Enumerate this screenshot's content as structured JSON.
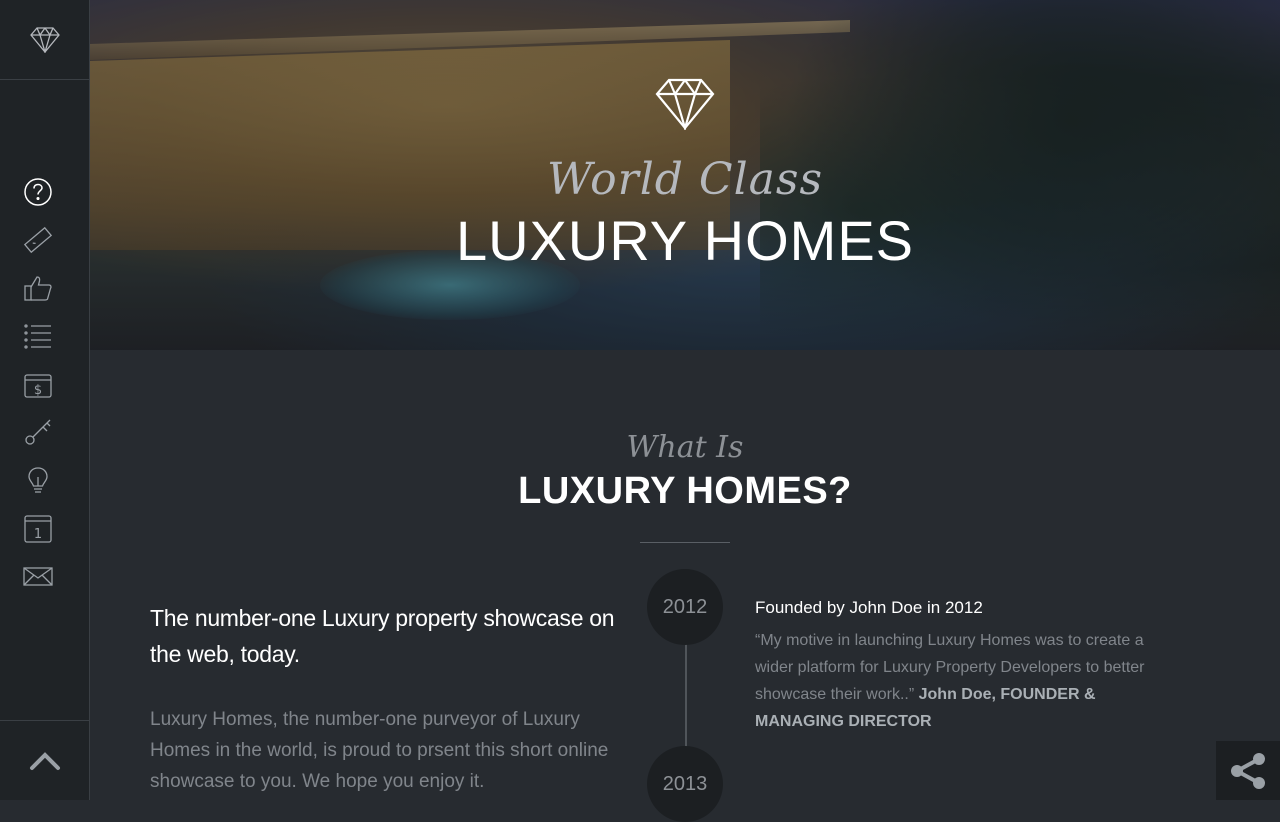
{
  "hero": {
    "script_text": "World Class",
    "title": "LUXURY HOMES"
  },
  "sidebar": {
    "logo_icon": "diamond-icon",
    "items": [
      {
        "icon": "question-icon"
      },
      {
        "icon": "ruler-icon"
      },
      {
        "icon": "thumbs-up-icon"
      },
      {
        "icon": "list-icon"
      },
      {
        "icon": "money-icon"
      },
      {
        "icon": "key-icon"
      },
      {
        "icon": "lightbulb-icon"
      },
      {
        "icon": "calendar-icon"
      },
      {
        "icon": "envelope-icon"
      }
    ],
    "bottom_icon": "chevron-up-icon"
  },
  "about": {
    "script_text": "What Is",
    "title": "LUXURY HOMES?",
    "lead": "The number-one Luxury property showcase on the web, today.",
    "body": "Luxury Homes, the number-one purveyor of Luxury Homes in the world, is proud to prsent this short online showcase to you. We hope you enjoy it."
  },
  "timeline": [
    {
      "year": "2012",
      "title": "Founded by John Doe in 2012",
      "quote": "“My motive in launching Luxury Homes was to create a wider platform for Luxury Property Developers to better showcase their work..”",
      "author": "John Doe, FOUNDER & MANAGING DIRECTOR"
    },
    {
      "year": "2013"
    }
  ],
  "share_icon": "share-icon",
  "colors": {
    "background": "#272b30",
    "sidebar": "#1f2326",
    "text_primary": "#ffffff",
    "text_muted": "#80858b"
  }
}
